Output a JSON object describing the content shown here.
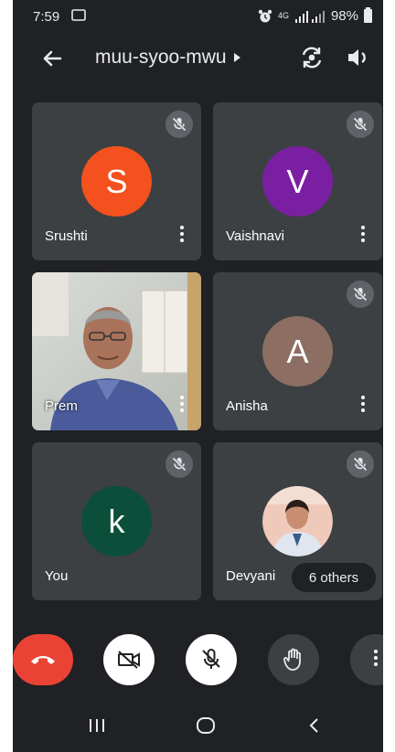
{
  "status_bar": {
    "time": "7:59",
    "network": "4G",
    "battery": "98%"
  },
  "header": {
    "title": "muu-syoo-mwu"
  },
  "tiles": [
    {
      "name": "Srushti",
      "initial": "S",
      "avatar_color": "#f4511e",
      "muted": true
    },
    {
      "name": "Vaishnavi",
      "initial": "V",
      "avatar_color": "#7b1fa2",
      "muted": true
    },
    {
      "name": "Prem",
      "has_video": true,
      "muted": false
    },
    {
      "name": "Anisha",
      "initial": "A",
      "avatar_color": "#8d6e63",
      "muted": true
    },
    {
      "name": "You",
      "initial": "k",
      "avatar_color": "#0b4f3a",
      "muted": true
    },
    {
      "name": "Devyani",
      "has_photo": true,
      "muted": true
    }
  ],
  "others_pill": "6 others",
  "controls": {
    "end_call_color": "#ea4335",
    "items": [
      "end-call",
      "camera-off",
      "mic-off",
      "raise-hand",
      "more-options"
    ]
  },
  "colors": {
    "background": "#202124",
    "tile": "#3c4043",
    "mute_badge": "#5f6368"
  }
}
